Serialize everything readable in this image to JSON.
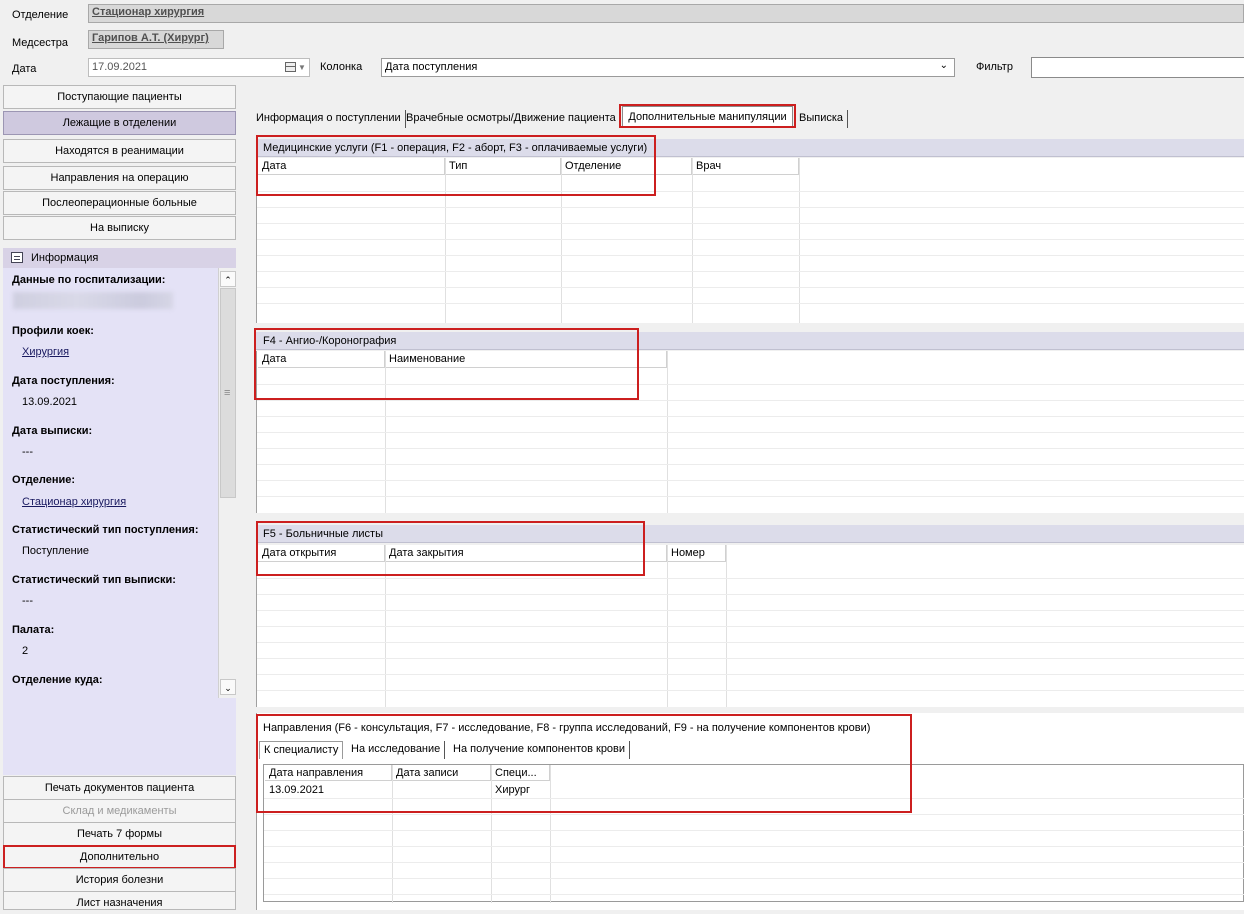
{
  "header": {
    "department_label": "Отделение",
    "department_value": "Стационар  хирургия",
    "nurse_label": "Медсестра",
    "nurse_value": "Гарипов А.Т. (Хирург)",
    "date_label": "Дата",
    "date_value": "17.09.2021",
    "column_label": "Колонка",
    "column_value": "Дата поступления",
    "filter_label": "Фильтр",
    "filter_value": ""
  },
  "nav": {
    "items": [
      {
        "label": "Поступающие пациенты"
      },
      {
        "label": "Лежащие в отделении"
      },
      {
        "label": "Находятся в реанимации"
      },
      {
        "label": "Направления на операцию"
      },
      {
        "label": "Послеоперационные больные"
      },
      {
        "label": "На выписку"
      }
    ]
  },
  "info": {
    "header": "Информация",
    "hosp_data_label": "Данные по госпитализации:",
    "bed_profiles_label": "Профили коек:",
    "bed_profiles_value": "Хирургия",
    "admission_date_label": "Дата поступления:",
    "admission_date_value": "13.09.2021",
    "discharge_date_label": "Дата выписки:",
    "discharge_date_value": "---",
    "department_label": "Отделение:",
    "department_value": "Стационар  хирургия",
    "stat_admission_label": "Статистический тип поступления:",
    "stat_admission_value": "Поступление",
    "stat_discharge_label": "Статистический тип выписки:",
    "stat_discharge_value": "---",
    "ward_label": "Палата:",
    "ward_value": "2",
    "dest_department_label": "Отделение куда:"
  },
  "bottom_nav": {
    "items": [
      {
        "label": "Печать документов пациента"
      },
      {
        "label": "Склад и медикаменты"
      },
      {
        "label": "Печать 7 формы"
      },
      {
        "label": "Дополнительно"
      },
      {
        "label": "История болезни"
      },
      {
        "label": "Лист назначения"
      }
    ]
  },
  "tabs": [
    {
      "label": "Информация о поступлении"
    },
    {
      "label": "Врачебные осмотры/Движение пациента"
    },
    {
      "label": "Дополнительные манипуляции"
    },
    {
      "label": "Выписка"
    }
  ],
  "medical_services": {
    "title": "Медицинские услуги (F1 - операция, F2 - аборт, F3 - оплачиваемые услуги)",
    "columns": [
      "Дата",
      "Тип",
      "Отделение",
      "Врач"
    ]
  },
  "angio": {
    "title": "F4 - Ангио-/Коронография",
    "columns": [
      "Дата",
      "Наименование"
    ]
  },
  "sick_leave": {
    "title": "F5 - Больничные листы",
    "columns": [
      "Дата открытия",
      "Дата закрытия",
      "Номер"
    ]
  },
  "referrals": {
    "title": "Направления (F6 - консультация, F7 - исследование, F8 - группа исследований, F9 - на получение компонентов крови)",
    "tabs": [
      "К специалисту",
      "На исследование",
      "На получение компонентов крови"
    ],
    "columns": [
      "Дата направления",
      "Дата записи",
      "Специ..."
    ],
    "rows": [
      [
        "13.09.2021",
        "",
        "Хирург"
      ]
    ]
  },
  "colors": {
    "accent_purple": "#cfc9df",
    "highlight_red": "#cc1f1f",
    "section_bg": "#dcdcea"
  }
}
